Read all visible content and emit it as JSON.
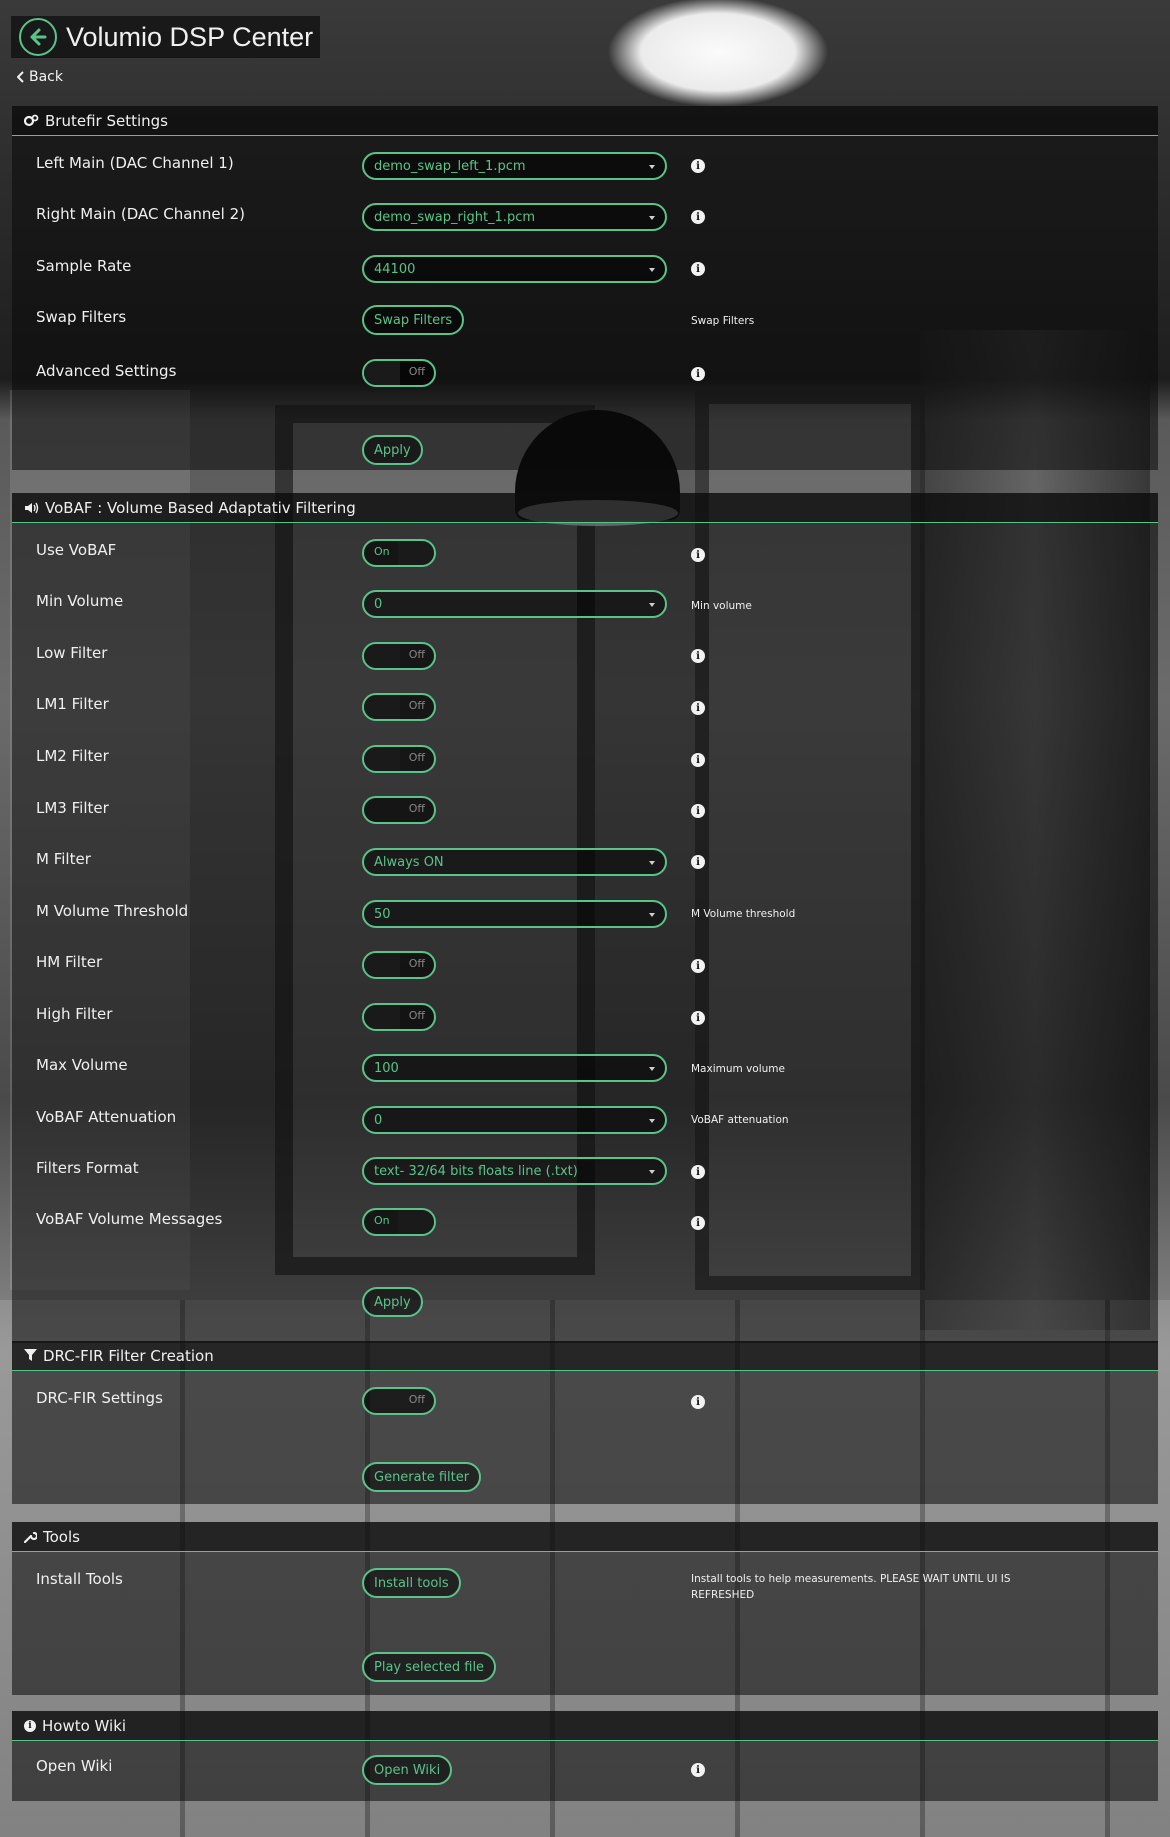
{
  "app": {
    "title": "Volumio DSP Center",
    "back_label": "Back"
  },
  "sections": {
    "brutefir": {
      "title": "Brutefir Settings",
      "icon": "gears-icon",
      "left_main": {
        "label": "Left Main (DAC Channel 1)",
        "value": "demo_swap_left_1.pcm"
      },
      "right_main": {
        "label": "Right Main (DAC Channel 2)",
        "value": "demo_swap_right_1.pcm"
      },
      "sample_rate": {
        "label": "Sample Rate",
        "value": "44100"
      },
      "swap_filters": {
        "label": "Swap Filters",
        "button": "Swap Filters",
        "help": "Swap Filters"
      },
      "advanced": {
        "label": "Advanced Settings",
        "state": "Off"
      },
      "apply": "Apply"
    },
    "vobaf": {
      "title": "VoBAF : Volume Based Adaptativ Filtering",
      "icon": "volume-icon",
      "use_vobaf": {
        "label": "Use VoBAF",
        "state": "On"
      },
      "min_volume": {
        "label": "Min Volume",
        "value": "0",
        "help": "Min volume"
      },
      "low_filter": {
        "label": "Low Filter",
        "state": "Off"
      },
      "lm1_filter": {
        "label": "LM1 Filter",
        "state": "Off"
      },
      "lm2_filter": {
        "label": "LM2 Filter",
        "state": "Off"
      },
      "lm3_filter": {
        "label": "LM3 Filter",
        "state": "Off"
      },
      "m_filter": {
        "label": "M Filter",
        "value": "Always ON"
      },
      "m_volume_threshold": {
        "label": "M Volume Threshold",
        "value": "50",
        "help": "M Volume threshold"
      },
      "hm_filter": {
        "label": "HM Filter",
        "state": "Off"
      },
      "high_filter": {
        "label": "High Filter",
        "state": "Off"
      },
      "max_volume": {
        "label": "Max Volume",
        "value": "100",
        "help": "Maximum volume"
      },
      "attenuation": {
        "label": "VoBAF Attenuation",
        "value": "0",
        "help": "VoBAF attenuation"
      },
      "filters_format": {
        "label": "Filters Format",
        "value": "text- 32/64 bits floats line (.txt)"
      },
      "volume_messages": {
        "label": "VoBAF Volume Messages",
        "state": "On"
      },
      "apply": "Apply"
    },
    "drc": {
      "title": "DRC-FIR Filter Creation",
      "icon": "filter-icon",
      "settings": {
        "label": "DRC-FIR Settings",
        "state": "Off"
      },
      "generate": "Generate filter"
    },
    "tools": {
      "title": "Tools",
      "icon": "wrench-icon",
      "install": {
        "label": "Install Tools",
        "button": "Install tools",
        "help": "Install tools to help measurements. PLEASE WAIT UNTIL UI IS REFRESHED"
      },
      "play": "Play selected file"
    },
    "wiki": {
      "title": "Howto Wiki",
      "icon": "info-icon",
      "open": {
        "label": "Open Wiki",
        "button": "Open Wiki"
      }
    }
  },
  "colors": {
    "accent": "#5ac38a",
    "panel": "#0c0c0c",
    "text": "#f0f0f0"
  }
}
